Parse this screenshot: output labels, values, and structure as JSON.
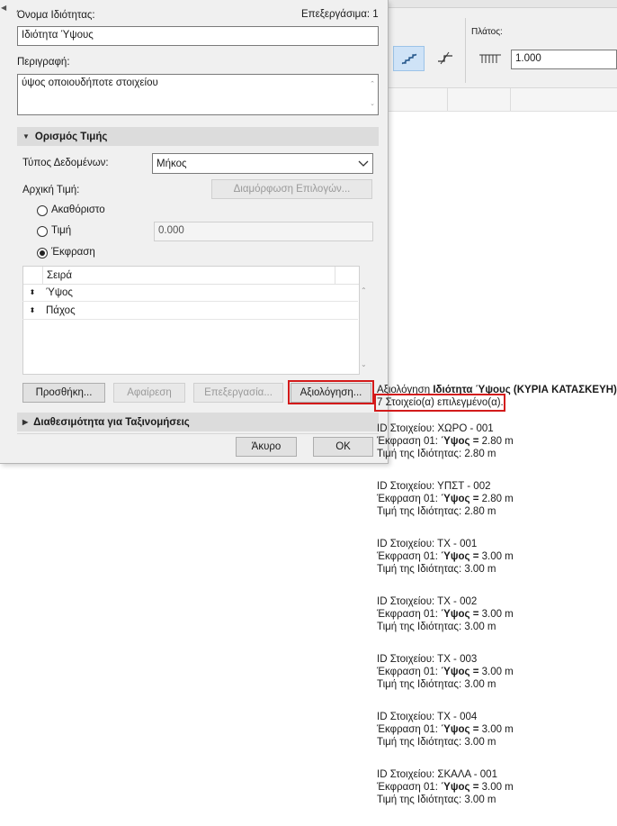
{
  "background": {
    "width_label": "Πλάτος:",
    "width_value": "1.000"
  },
  "dialog": {
    "name_label": "Όνομα Ιδιότητας:",
    "edit_count": "Επεξεργάσιμα: 1",
    "name_value": "Ιδιότητα Ύψους",
    "description_label": "Περιγραφή:",
    "description_value": "ύψος οποιουδήποτε στοιχείου",
    "value_section": "Ορισμός Τιμής",
    "data_type_label": "Τύπος Δεδομένων:",
    "data_type_value": "Μήκος",
    "default_value_label": "Αρχική Τιμή:",
    "configure_options_button": "Διαμόρφωση Επιλογών...",
    "radio_undefined": "Ακαθόριστο",
    "radio_value": "Τιμή",
    "value_field": "0.000",
    "radio_expression": "Έκφραση",
    "order_header": "Σειρά",
    "expressions": [
      "Ύψος",
      "Πάχος"
    ],
    "add_button": "Προσθήκη...",
    "remove_button": "Αφαίρεση",
    "edit_button": "Επεξεργασία...",
    "evaluate_button": "Αξιολόγηση...",
    "classification_section": "Διαθεσιμότητα για Ταξινομήσεις",
    "cancel_button": "Άκυρο",
    "ok_button": "OK"
  },
  "evaluation": {
    "header_prefix": "Αξιολόγηση ",
    "header_property": "Ιδιότητα Ύψους",
    "header_suffix": " (ΚΥΡΙΑ ΚΑΤΑΣΚΕΥΗ)",
    "selected_count": "7 Στοιχείο(α) επιλεγμένο(α).",
    "id_prefix": "ID Στοιχείου: ",
    "expr_prefix": "Έκφραση 01: ",
    "expr_name": "Ύψος",
    "expr_equals": " = ",
    "value_prefix": "Τιμή της Ιδιότητας: ",
    "items": [
      {
        "id": "ΧΩΡΟ - 001",
        "expr": "2.80 m",
        "value": "2.80 m"
      },
      {
        "id": "ΥΠΣΤ - 002",
        "expr": "2.80 m",
        "value": "2.80 m"
      },
      {
        "id": "ΤΧ - 001",
        "expr": "3.00 m",
        "value": "3.00 m"
      },
      {
        "id": "ΤΧ - 002",
        "expr": "3.00 m",
        "value": "3.00 m"
      },
      {
        "id": "ΤΧ - 003",
        "expr": "3.00 m",
        "value": "3.00 m"
      },
      {
        "id": "ΤΧ - 004",
        "expr": "3.00 m",
        "value": "3.00 m"
      },
      {
        "id": "ΣΚΑΛΑ - 001",
        "expr": "3.00 m",
        "value": "3.00 m"
      }
    ]
  },
  "colors": {
    "highlight": "#d31a1a",
    "section_bg": "#dcdcdc"
  },
  "icons": [
    "stair-icon",
    "step-icon",
    "width-icon",
    "chevron-down-icon",
    "sort-arrows-icon"
  ]
}
